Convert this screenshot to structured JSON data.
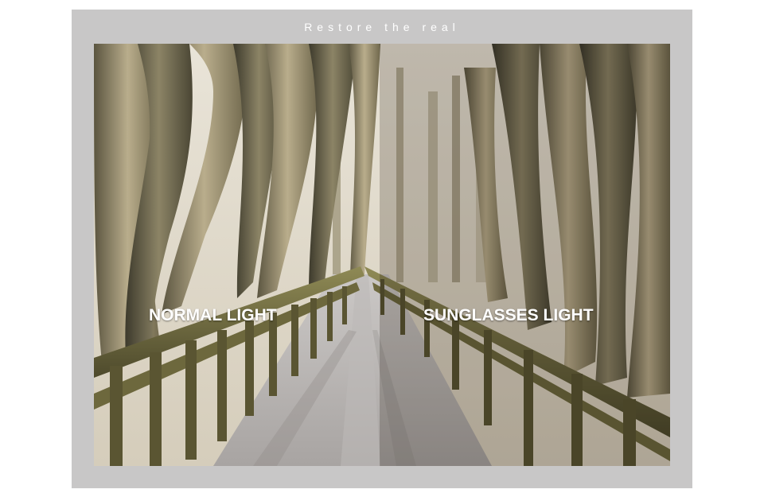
{
  "headline": "Restore the real",
  "comparison": {
    "left_label": "NORMAL LIGHT",
    "right_label": "SUNGLASSES LIGHT"
  },
  "colors": {
    "frame": "#c8c7c7",
    "label_text": "#ffffff",
    "tint_overlay": "#5a4e46"
  }
}
